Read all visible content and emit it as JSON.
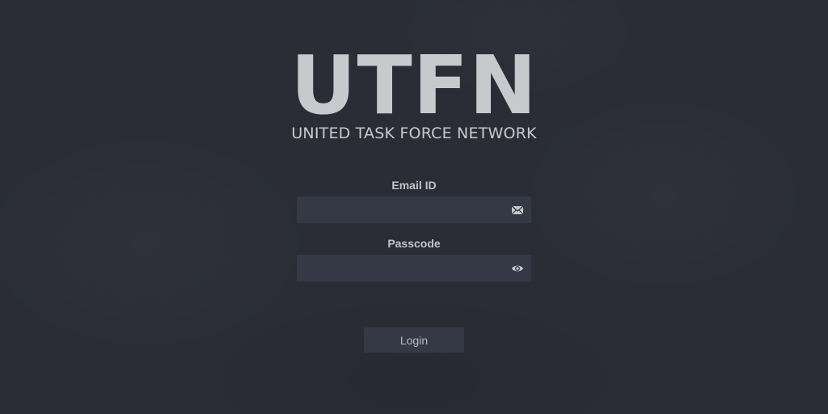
{
  "brand": {
    "logo_text": "UTFN",
    "subtitle": "UNITED TASK FORCE NETWORK"
  },
  "form": {
    "email": {
      "label": "Email ID",
      "value": "",
      "placeholder": "",
      "icon": "envelope-icon"
    },
    "passcode": {
      "label": "Passcode",
      "value": "",
      "placeholder": "",
      "icon": "eye-icon"
    },
    "login_label": "Login"
  },
  "colors": {
    "background": "#2a2d36",
    "field_background": "#353945",
    "text": "#c3c4c7"
  }
}
